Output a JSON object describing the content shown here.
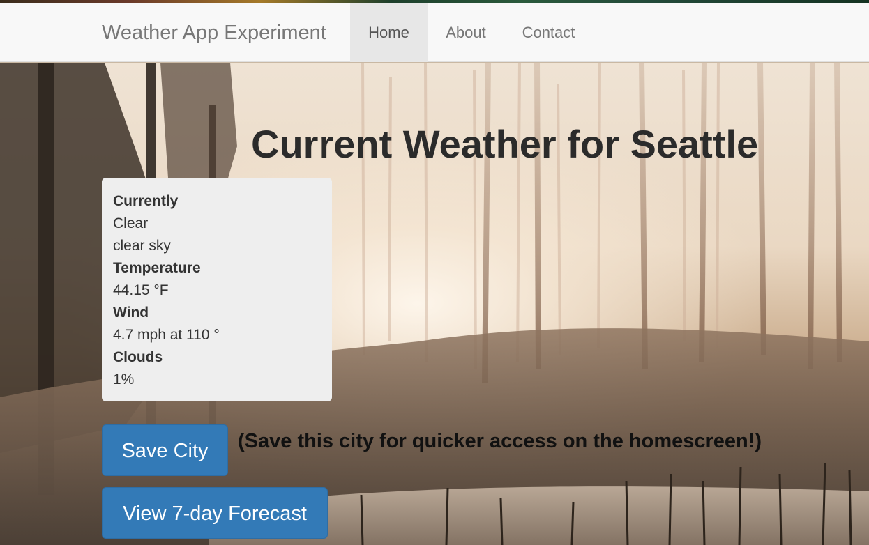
{
  "navbar": {
    "brand": "Weather App Experiment",
    "items": [
      {
        "label": "Home",
        "active": true
      },
      {
        "label": "About",
        "active": false
      },
      {
        "label": "Contact",
        "active": false
      }
    ]
  },
  "main": {
    "title": "Current Weather for Seattle",
    "weather": {
      "currently_label": "Currently",
      "condition": "Clear",
      "description": "clear sky",
      "temperature_label": "Temperature",
      "temperature_value": "44.15 °F",
      "wind_label": "Wind",
      "wind_value": "4.7 mph at 110 °",
      "clouds_label": "Clouds",
      "clouds_value": "1%"
    },
    "save_button_label": "Save City",
    "save_note": "(Save this city for quicker access on the homescreen!)",
    "forecast_button_label": "View 7-day Forecast"
  },
  "colors": {
    "primary": "#337ab7",
    "navbar_bg": "#f8f8f8",
    "nav_active_bg": "#e7e7e7",
    "card_bg": "#eeeeee"
  },
  "background": "foggy-forest-photo"
}
